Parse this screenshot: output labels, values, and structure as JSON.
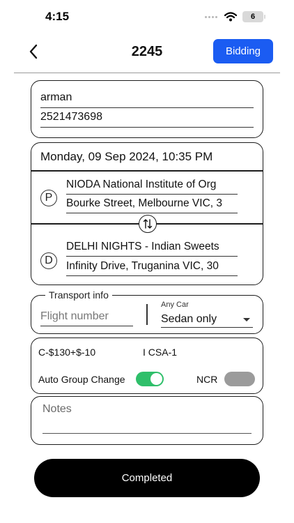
{
  "status_bar": {
    "time": "4:15",
    "battery_level": "6",
    "icons": [
      "signal-dots-icon",
      "wifi-icon",
      "battery-icon"
    ]
  },
  "nav": {
    "title": "2245",
    "back_icon": "chevron-left-icon",
    "bidding_label": "Bidding",
    "accent_color": "#1b5cf2"
  },
  "contact": {
    "name": "arman",
    "phone": "2521473698"
  },
  "trip": {
    "datetime": "Monday, 09 Sep 2024, 10:35 PM",
    "pickup": {
      "badge": "P",
      "place": "NIODA National Institute of Org",
      "address": "Bourke Street, Melbourne VIC, 3"
    },
    "dropoff": {
      "badge": "D",
      "place": "DELHI NIGHTS - Indian Sweets",
      "address": "Infinity Drive, Truganina VIC, 30"
    },
    "swap_icon": "swap-vertical-icon"
  },
  "transport": {
    "legend": "Transport info",
    "flight_placeholder": "Flight number",
    "car_label": "Any Car",
    "car_value": "Sedan only"
  },
  "fare": {
    "fare_text": "C-$130+$-10",
    "csa_text": "I  CSA-1",
    "auto_group_label": "Auto Group Change",
    "auto_group_on": true,
    "ncr_label": "NCR",
    "ncr_on": false,
    "toggle_on_color": "#2fbf6a",
    "toggle_off_color": "#9b9b9b"
  },
  "notes": {
    "placeholder": "Notes"
  },
  "actions": {
    "completed_label": "Completed"
  }
}
